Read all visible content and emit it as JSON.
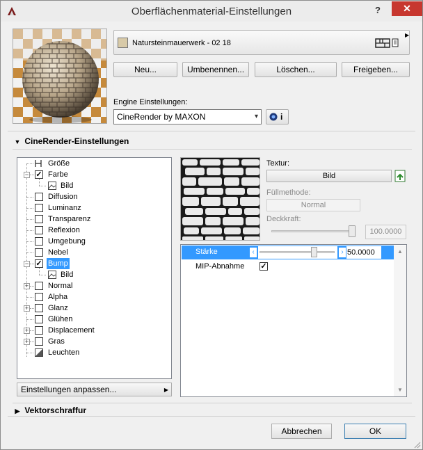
{
  "window": {
    "title": "Oberflächenmaterial-Einstellungen",
    "help_label": "?",
    "close_label": "✕"
  },
  "material": {
    "name": "Natursteinmauerwerk - 02 18",
    "swatch_color": "#d8caa8"
  },
  "actions": {
    "new_label": "Neu...",
    "rename_label": "Umbenennen...",
    "delete_label": "Löschen...",
    "share_label": "Freigeben..."
  },
  "engine": {
    "label": "Engine Einstellungen:",
    "selected": "CineRender by MAXON",
    "info_label": "i"
  },
  "cinerender_section": {
    "title": "CineRender-Einstellungen"
  },
  "channels": [
    {
      "label": "Größe",
      "checked": false
    },
    {
      "label": "Farbe",
      "checked": true
    },
    {
      "label": "Bild",
      "checked": false
    },
    {
      "label": "Diffusion",
      "checked": false
    },
    {
      "label": "Luminanz",
      "checked": false
    },
    {
      "label": "Transparenz",
      "checked": false
    },
    {
      "label": "Reflexion",
      "checked": false
    },
    {
      "label": "Umgebung",
      "checked": false
    },
    {
      "label": "Nebel",
      "checked": false
    },
    {
      "label": "Bump",
      "checked": true,
      "selected": true
    },
    {
      "label": "Bild",
      "checked": false
    },
    {
      "label": "Normal",
      "checked": false
    },
    {
      "label": "Alpha",
      "checked": false
    },
    {
      "label": "Glanz",
      "checked": false
    },
    {
      "label": "Glühen",
      "checked": false
    },
    {
      "label": "Displacement",
      "checked": false
    },
    {
      "label": "Gras",
      "checked": false
    },
    {
      "label": "Leuchten",
      "checked": false
    }
  ],
  "adjust_settings_label": "Einstellungen anpassen...",
  "texture": {
    "label": "Textur:",
    "button_label": "Bild",
    "fill_method_label": "Füllmethode:",
    "fill_method_value": "Normal",
    "opacity_label": "Deckkraft:",
    "opacity_value": "100.0000",
    "opacity_fraction": 1.0
  },
  "params": [
    {
      "label": "Stärke",
      "value": "50.0000",
      "fraction": 0.5
    },
    {
      "label": "MIP-Abnahme",
      "checked": true
    }
  ],
  "vector_section": {
    "title": "Vektorschraffur"
  },
  "footer": {
    "cancel_label": "Abbrechen",
    "ok_label": "OK"
  },
  "colors": {
    "selection": "#3399ff",
    "close_button": "#c7372f"
  }
}
